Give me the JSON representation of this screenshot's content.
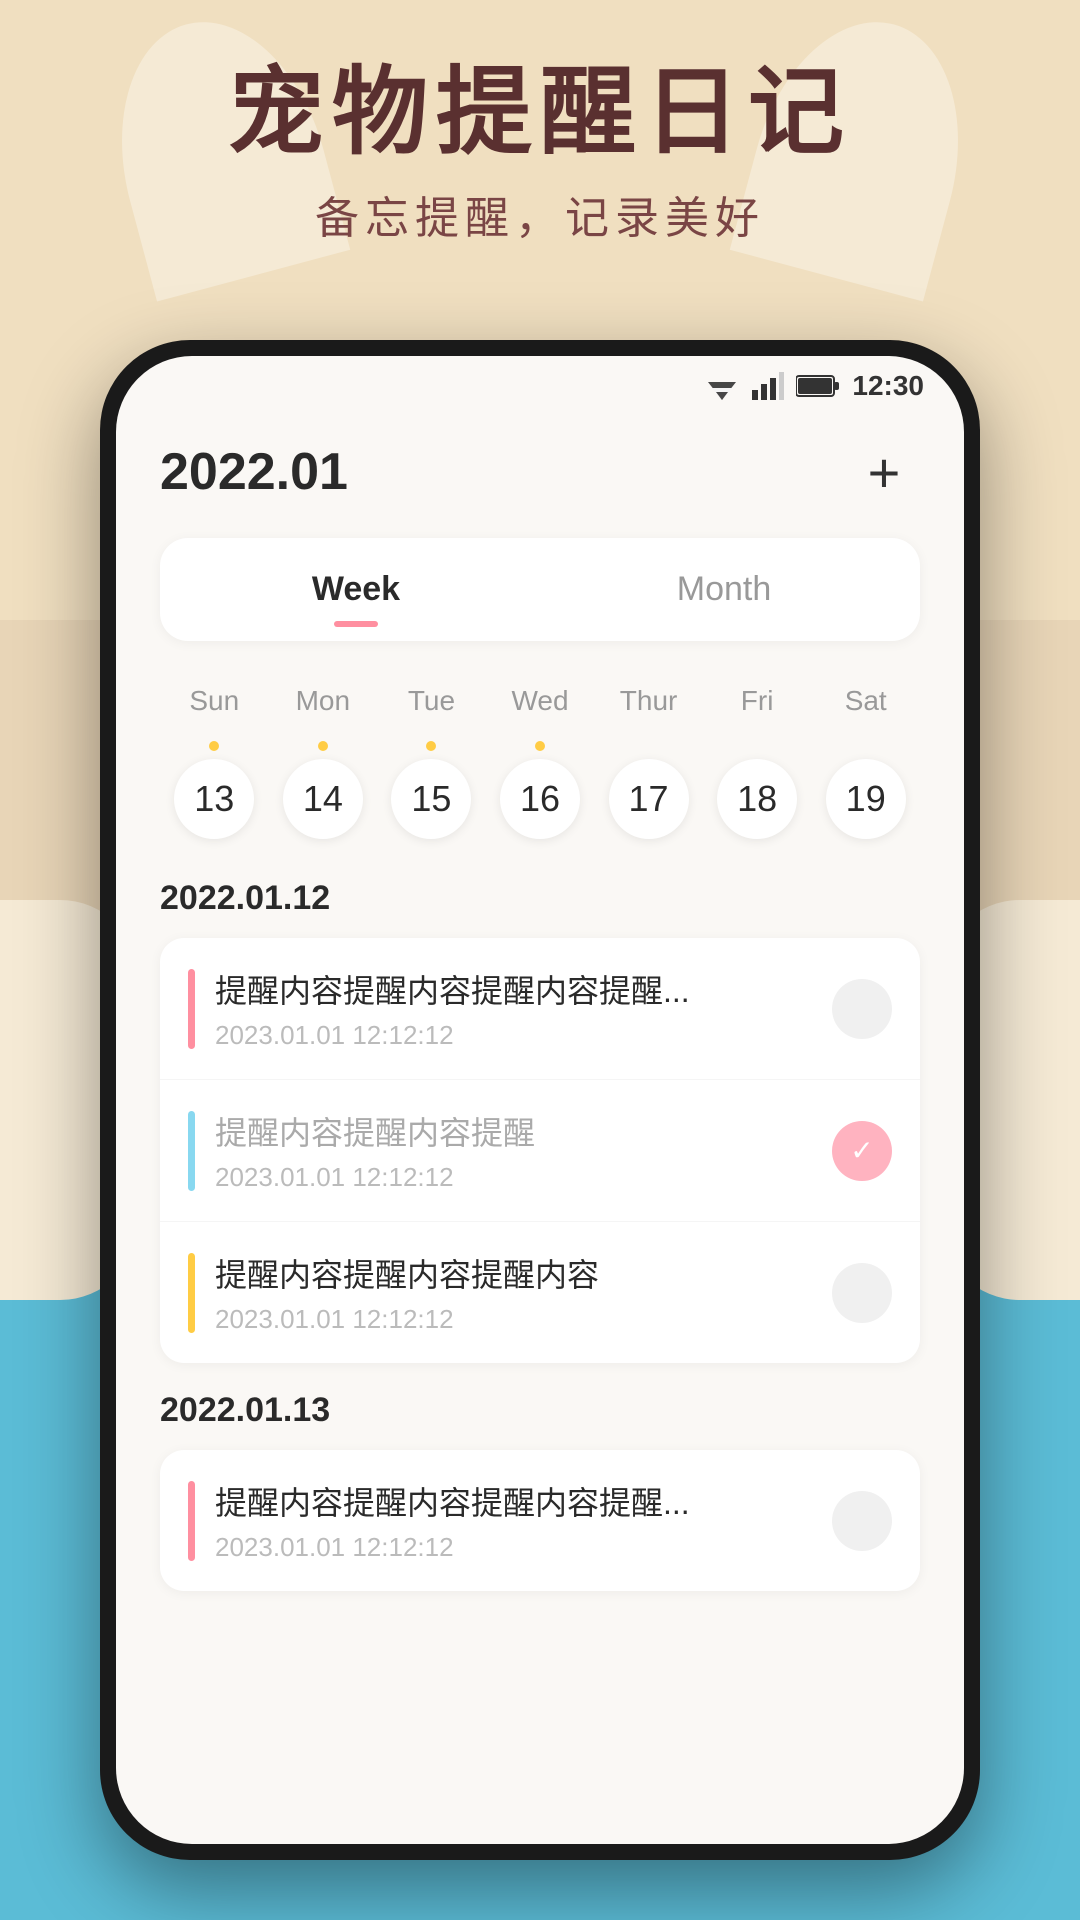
{
  "background": {
    "top_color": "#f0dfc0",
    "bottom_color": "#5bbcd6"
  },
  "app": {
    "title": "宠物提醒日记",
    "subtitle": "备忘提醒，记录美好"
  },
  "status_bar": {
    "time": "12:30"
  },
  "header": {
    "current_date": "2022.01",
    "add_btn_label": "+"
  },
  "tabs": [
    {
      "id": "week",
      "label": "Week",
      "active": true
    },
    {
      "id": "month",
      "label": "Month",
      "active": false
    }
  ],
  "week_days": {
    "headers": [
      "Sun",
      "Mon",
      "Tue",
      "Wed",
      "Thur",
      "Fri",
      "Sat"
    ],
    "dates": [
      {
        "num": "13",
        "dot": true
      },
      {
        "num": "14",
        "dot": true
      },
      {
        "num": "15",
        "dot": true
      },
      {
        "num": "16",
        "dot": true
      },
      {
        "num": "17",
        "dot": false
      },
      {
        "num": "18",
        "dot": false
      },
      {
        "num": "19",
        "dot": false
      }
    ]
  },
  "sections": [
    {
      "date": "2022.01.12",
      "events": [
        {
          "bar_color": "#ff8fa0",
          "title": "提醒内容提醒内容提醒内容提醒...",
          "time": "2023.01.01  12:12:12",
          "checked": false,
          "dimmed": false
        },
        {
          "bar_color": "#88d8f0",
          "title": "提醒内容提醒内容提醒",
          "time": "2023.01.01  12:12:12",
          "checked": true,
          "dimmed": true
        },
        {
          "bar_color": "#ffcc44",
          "title": "提醒内容提醒内容提醒内容",
          "time": "2023.01.01  12:12:12",
          "checked": false,
          "dimmed": false
        }
      ]
    },
    {
      "date": "2022.01.13",
      "events": [
        {
          "bar_color": "#ff8fa0",
          "title": "提醒内容提醒内容提醒内容提醒...",
          "time": "2023.01.01  12:12:12",
          "checked": false,
          "dimmed": false
        }
      ]
    }
  ]
}
